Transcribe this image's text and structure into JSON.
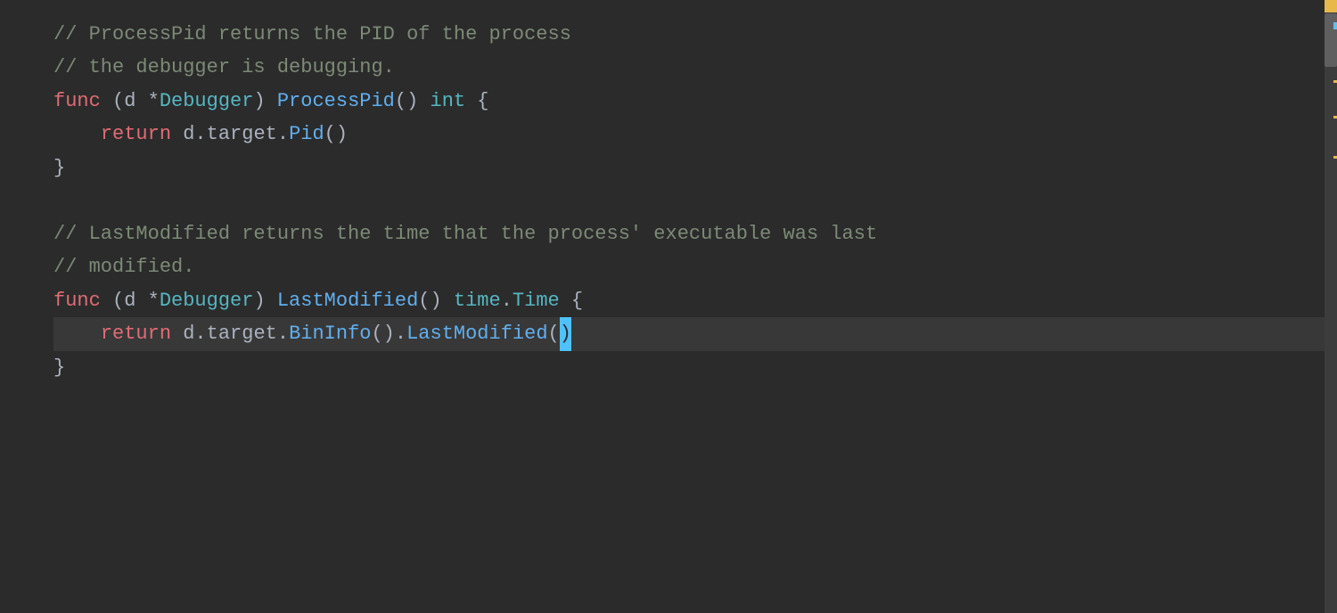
{
  "editor": {
    "background": "#2b2b2b",
    "lines": [
      {
        "id": "line1",
        "type": "comment",
        "content": "// ProcessPid returns the PID of the process"
      },
      {
        "id": "line2",
        "type": "comment",
        "content": "// the debugger is debugging."
      },
      {
        "id": "line3",
        "type": "code",
        "parts": [
          {
            "text": "func",
            "class": "keyword"
          },
          {
            "text": " (",
            "class": "plain"
          },
          {
            "text": "d",
            "class": "plain"
          },
          {
            "text": " *",
            "class": "plain"
          },
          {
            "text": "Debugger",
            "class": "type"
          },
          {
            "text": ") ",
            "class": "plain"
          },
          {
            "text": "ProcessPid",
            "class": "func-name"
          },
          {
            "text": "()",
            "class": "plain"
          },
          {
            "text": " int",
            "class": "type"
          },
          {
            "text": " {",
            "class": "brace"
          }
        ]
      },
      {
        "id": "line4",
        "type": "code",
        "indent": true,
        "parts": [
          {
            "text": "return",
            "class": "keyword"
          },
          {
            "text": " d",
            "class": "plain"
          },
          {
            "text": ".target.",
            "class": "plain"
          },
          {
            "text": "Pid",
            "class": "method"
          },
          {
            "text": "()",
            "class": "plain"
          }
        ]
      },
      {
        "id": "line5",
        "type": "code",
        "parts": [
          {
            "text": "}",
            "class": "brace"
          }
        ]
      },
      {
        "id": "line6",
        "type": "empty"
      },
      {
        "id": "line7",
        "type": "comment",
        "content": "// LastModified returns the time that the process' executable was last"
      },
      {
        "id": "line8",
        "type": "comment",
        "content": "// modified."
      },
      {
        "id": "line9",
        "type": "code",
        "parts": [
          {
            "text": "func",
            "class": "keyword"
          },
          {
            "text": " (",
            "class": "plain"
          },
          {
            "text": "d",
            "class": "plain"
          },
          {
            "text": " *",
            "class": "plain"
          },
          {
            "text": "Debugger",
            "class": "type"
          },
          {
            "text": ") ",
            "class": "plain"
          },
          {
            "text": "LastModified",
            "class": "func-name"
          },
          {
            "text": "() ",
            "class": "plain"
          },
          {
            "text": "time",
            "class": "type"
          },
          {
            "text": ".",
            "class": "plain"
          },
          {
            "text": "Time",
            "class": "type"
          },
          {
            "text": " {",
            "class": "brace"
          }
        ]
      },
      {
        "id": "line10",
        "type": "code",
        "indent": true,
        "highlighted": true,
        "parts": [
          {
            "text": "return",
            "class": "keyword"
          },
          {
            "text": " d",
            "class": "plain"
          },
          {
            "text": ".target.",
            "class": "plain"
          },
          {
            "text": "BinInfo",
            "class": "method"
          },
          {
            "text": "().",
            "class": "plain"
          },
          {
            "text": "LastModified",
            "class": "method"
          },
          {
            "text": "(",
            "class": "plain"
          },
          {
            "text": ")",
            "class": "cursor-block"
          },
          {
            "text": "",
            "class": "plain"
          }
        ]
      },
      {
        "id": "line11",
        "type": "code",
        "parts": [
          {
            "text": "}",
            "class": "brace"
          }
        ]
      }
    ]
  }
}
